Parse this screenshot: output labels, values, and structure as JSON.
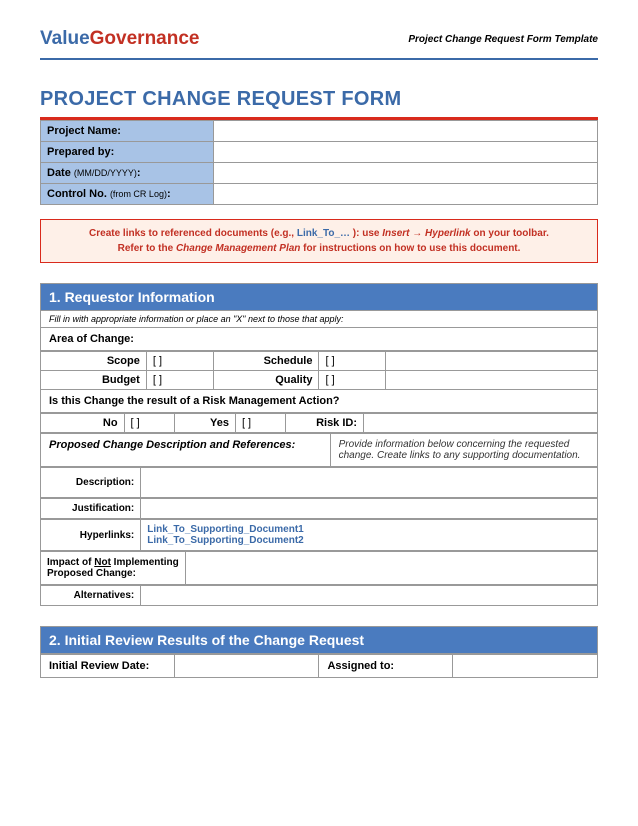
{
  "header": {
    "logo_value": "Value",
    "logo_gov": "Governance",
    "subtitle": "Project Change Request Form Template"
  },
  "title": "PROJECT CHANGE REQUEST FORM",
  "meta": {
    "project_name": "Project Name:",
    "prepared_by": "Prepared by:",
    "date_label": "Date ",
    "date_sub": "(MM/DD/YYYY)",
    "date_colon": ":",
    "control_label": "Control No. ",
    "control_sub": "(from CR Log)",
    "control_colon": ":"
  },
  "instruction": {
    "line1a": "Create links to referenced documents (e.g., ",
    "link": "Link_To_…",
    "line1b": " ): use ",
    "insert": "Insert",
    "arrow": " → ",
    "hyper": "Hyperlink",
    "line1c": " on your toolbar.",
    "line2a": "Refer to the ",
    "cmp": "Change Management Plan",
    "line2b": " for instructions on how to use this document."
  },
  "section1": {
    "title": "1.  Requestor Information",
    "hint": "Fill in with appropriate information or place an \"X\" next to those that apply:",
    "area": "Area of Change:",
    "scope": "Scope",
    "schedule": "Schedule",
    "budget": "Budget",
    "quality": "Quality",
    "bracket": "[   ]",
    "risk_q": "Is this Change the result of a Risk Management Action?",
    "no": "No",
    "yes": "Yes",
    "riskid": "Risk ID:",
    "proposed": "Proposed Change Description and References:",
    "proposed_hint": "Provide information below concerning the requested change. Create links to any supporting documentation.",
    "description": "Description:",
    "justification": "Justification:",
    "hyperlinks": "Hyperlinks:",
    "link1": "Link_To_Supporting_Document1",
    "link2": "Link_To_Supporting_Document2",
    "impact_a": "Impact of ",
    "impact_not": "Not",
    "impact_b": " Implementing Proposed Change:",
    "alternatives": "Alternatives:"
  },
  "section2": {
    "title": "2.  Initial Review Results of the Change Request",
    "review_date": "Initial Review Date:",
    "assigned": "Assigned to:"
  }
}
